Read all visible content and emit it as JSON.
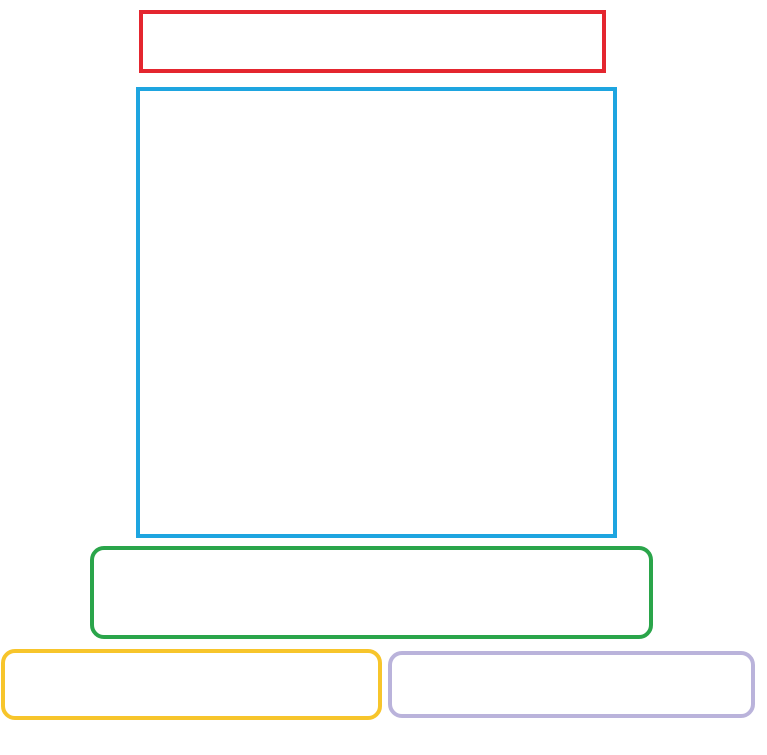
{
  "regions": {
    "title_bar": {
      "color": "#e4262f"
    },
    "main_panel": {
      "color": "#1ea5e0"
    },
    "center_bar": {
      "color": "#2aa54a"
    },
    "left_button": {
      "color": "#f7c52b"
    },
    "right_button": {
      "color": "#bab3db"
    }
  }
}
